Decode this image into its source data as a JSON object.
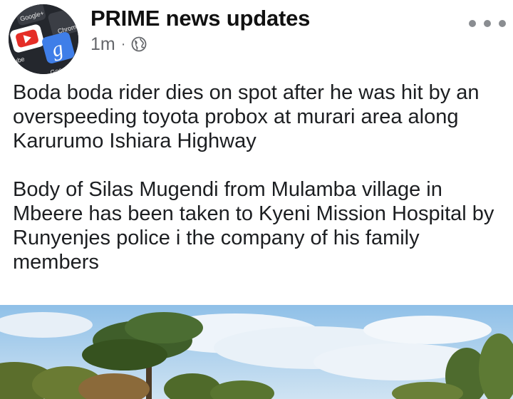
{
  "post": {
    "page_name": "PRIME news updates",
    "timestamp": "1m",
    "separator": "·",
    "audience_icon": "globe-icon",
    "more_icon": "more-options-icon",
    "paragraphs": [
      "Boda boda rider dies on spot after he was hit by an overspeeding toyota probox at murari area along Karurumo Ishiara Highway",
      "Body of Silas Mugendi from Mulamba village in Mbeere has been taken to Kyeni Mission Hospital by Runyenjes police i the company of his family members"
    ]
  },
  "avatar": {
    "app_labels": [
      "Google+",
      "Chrom",
      "Tube",
      "Googl"
    ],
    "icons": [
      "youtube-icon",
      "google-icon"
    ]
  },
  "colors": {
    "text": "#1c1e21",
    "meta": "#65676b",
    "youtube_red": "#e52d27",
    "google_blue": "#3f7ee8"
  }
}
